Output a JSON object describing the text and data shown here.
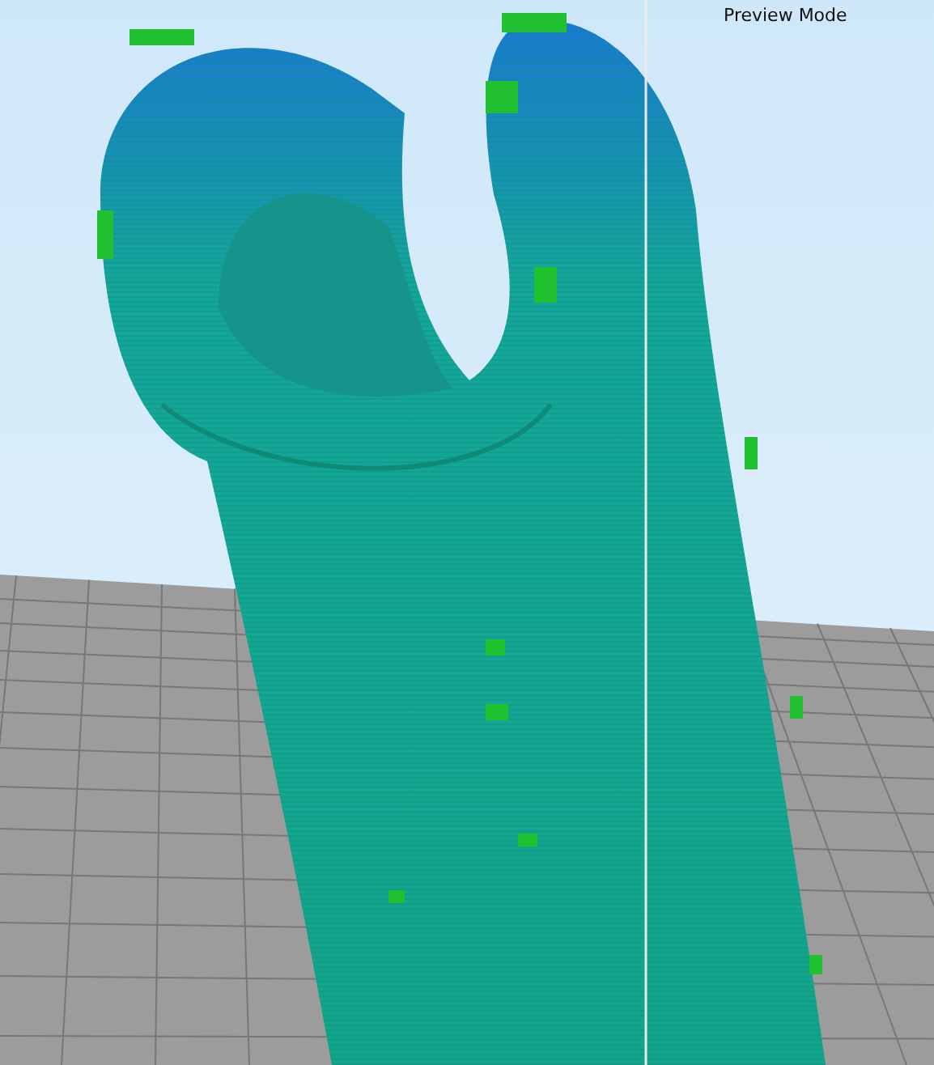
{
  "viewport": {
    "mode_label": "Preview Mode"
  }
}
